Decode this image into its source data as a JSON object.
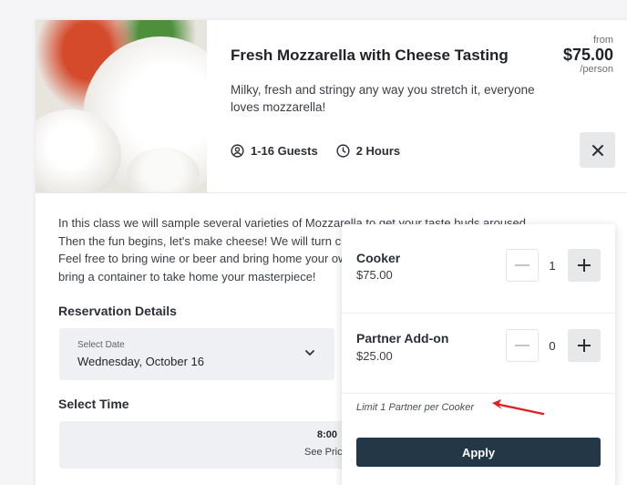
{
  "listing": {
    "title": "Fresh Mozzarella with Cheese Tasting",
    "description": "Milky, fresh and stringy any way you stretch it, everyone loves mozzarella!",
    "guests": "1-16 Guests",
    "duration": "2 Hours",
    "price_from": "from",
    "price": "$75.00",
    "price_unit": "/person",
    "image_alt": "mozzarella cheese photo"
  },
  "details": {
    "intro": "In this class we will sample several varieties of Mozzarella to get your taste buds aroused. Then the fun begins, let's make cheese! We will turn curds into delectable fresh mozzarella. Feel free to bring wine or beer and bring home your own delicious creation! Don't forget to bring a container to take home your masterpiece!",
    "reservation_heading": "Reservation Details",
    "date_label": "Select Date",
    "date_value": "Wednesday, October 16",
    "time_heading": "Select Time",
    "time_value": "8:00",
    "time_price_link": "See Pric"
  },
  "popover": {
    "items": [
      {
        "name": "Cooker",
        "price": "$75.00",
        "quantity": "1"
      },
      {
        "name": "Partner Add-on",
        "price": "$25.00",
        "quantity": "0"
      }
    ],
    "limit_note": "Limit 1 Partner per Cooker",
    "apply_label": "Apply"
  },
  "colors": {
    "apply_bg": "#233746",
    "arrow": "#e02020",
    "close_bg": "#e6e8ea"
  }
}
